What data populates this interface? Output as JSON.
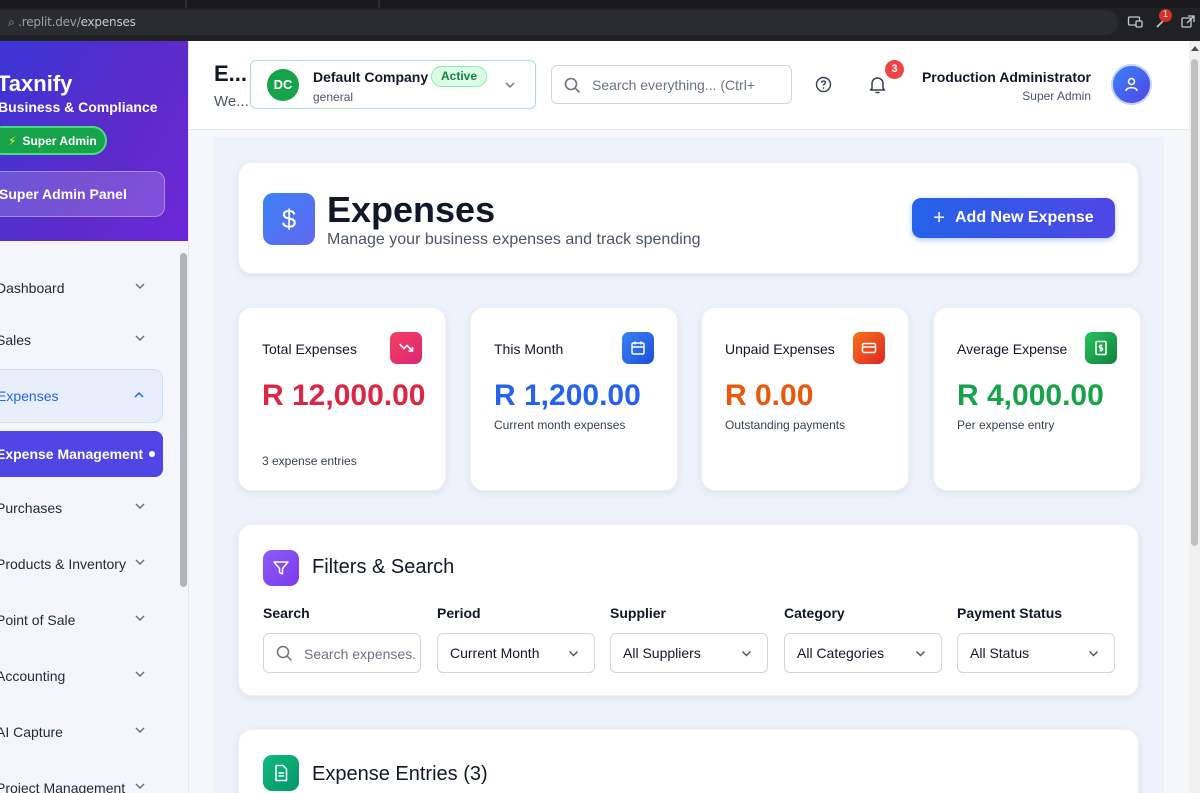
{
  "browser": {
    "url_prefix": "⌕ .replit.dev/",
    "url_path": "expenses",
    "ext_badge": "1"
  },
  "sidebar": {
    "brand": "Taxnify",
    "brand_sub": "Business & Compliance",
    "role_badge": "Super Admin",
    "panel_button": "Super Admin Panel",
    "items": [
      {
        "label": "Dashboard"
      },
      {
        "label": "Sales"
      },
      {
        "label": "Expenses"
      },
      {
        "label": "Expense Management"
      },
      {
        "label": "Purchases"
      },
      {
        "label": "Products & Inventory"
      },
      {
        "label": "Point of Sale"
      },
      {
        "label": "Accounting"
      },
      {
        "label": "AI Capture"
      },
      {
        "label": "Project Management"
      }
    ]
  },
  "header": {
    "title": "E...",
    "subtitle": "We...",
    "company": {
      "initials": "DC",
      "name": "Default Company",
      "status": "Active",
      "type": "general"
    },
    "search_placeholder": "Search everything... (Ctrl+",
    "notifications": "3",
    "user_name": "Production Administrator",
    "user_role": "Super Admin"
  },
  "page": {
    "title": "Expenses",
    "subtitle": "Manage your business expenses and track spending",
    "add_button": "Add New Expense"
  },
  "stats": [
    {
      "label": "Total Expenses",
      "value": "R 12,000.00",
      "desc": "3 expense entries",
      "color": "#dc2645",
      "icon": "trending-down-icon"
    },
    {
      "label": "This Month",
      "value": "R 1,200.00",
      "desc": "Current month expenses",
      "color": "#2563eb",
      "icon": "calendar-icon"
    },
    {
      "label": "Unpaid Expenses",
      "value": "R 0.00",
      "desc": "Outstanding payments",
      "color": "#ea580c",
      "icon": "credit-card-icon"
    },
    {
      "label": "Average Expense",
      "value": "R 4,000.00",
      "desc": "Per expense entry",
      "color": "#16a34a",
      "icon": "receipt-icon"
    }
  ],
  "filters": {
    "title": "Filters & Search",
    "search_label": "Search",
    "search_placeholder": "Search expenses...",
    "period_label": "Period",
    "period_value": "Current Month",
    "supplier_label": "Supplier",
    "supplier_value": "All Suppliers",
    "category_label": "Category",
    "category_value": "All Categories",
    "status_label": "Payment Status",
    "status_value": "All Status"
  },
  "entries": {
    "title": "Expense Entries (3)"
  }
}
